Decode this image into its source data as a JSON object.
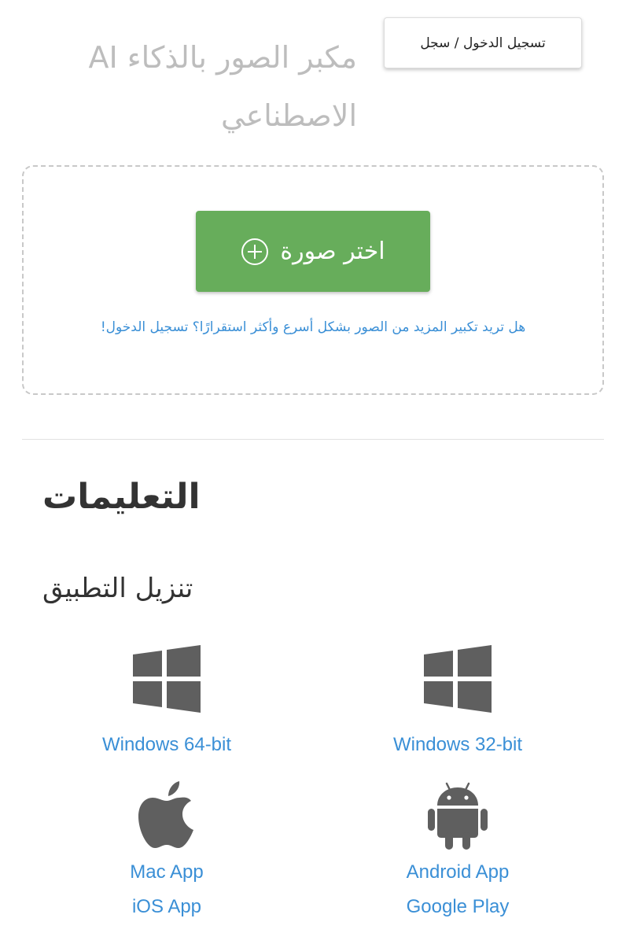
{
  "header": {
    "title": "مكبر الصور بالذكاء AI الاصطناعي",
    "login_label": "تسجيل الدخول / سجل"
  },
  "upload": {
    "choose_label": "اختر صورة",
    "more_link": "هل تريد تكبير المزيد من الصور بشكل أسرع وأكثر استقرارًا؟ تسجيل الدخول!"
  },
  "instructions": {
    "title": "التعليمات"
  },
  "download": {
    "title": "تنزيل التطبيق",
    "windows64": "Windows 64-bit",
    "windows32": "Windows 32-bit",
    "mac": "Mac App",
    "ios": "iOS App",
    "android": "Android App",
    "google_play": "Google Play"
  },
  "colors": {
    "accent_green": "#67ad5b",
    "link_blue": "#3a8fd6",
    "icon_gray": "#5f5f5f"
  },
  "icons": [
    "plus-circle-icon",
    "windows-icon",
    "apple-icon",
    "android-icon"
  ]
}
